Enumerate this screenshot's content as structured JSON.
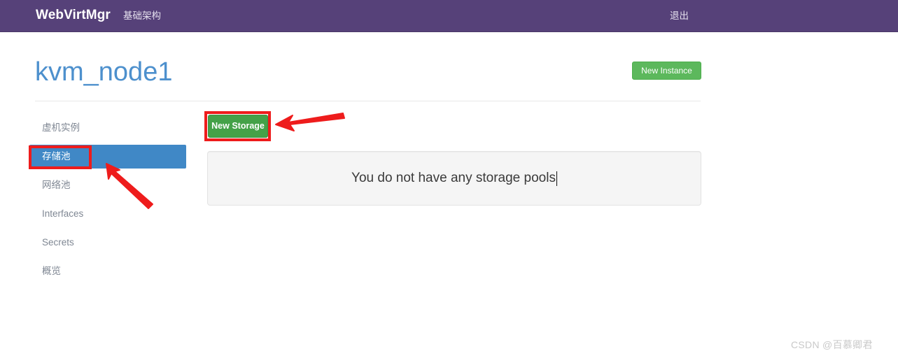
{
  "navbar": {
    "brand": "WebVirtMgr",
    "infrastructure_link": "基础架构",
    "logout_link": "退出",
    "background_color": "#564179"
  },
  "header": {
    "page_title": "kvm_node1",
    "title_color": "#4d90cd",
    "new_instance_button": "New Instance",
    "new_instance_color": "#5cb85c"
  },
  "sidebar": {
    "items": [
      {
        "label": "虚机实例",
        "active": false
      },
      {
        "label": "存储池",
        "active": true
      },
      {
        "label": "网络池",
        "active": false
      },
      {
        "label": "Interfaces",
        "active": false
      },
      {
        "label": "Secrets",
        "active": false
      },
      {
        "label": "概览",
        "active": false
      }
    ],
    "active_color": "#4088c6"
  },
  "main": {
    "new_storage_button": "New Storage",
    "new_storage_color": "#44a148",
    "empty_message": "You do not have any storage pools",
    "panel_background": "#f5f5f5"
  },
  "annotations": {
    "highlight_color": "#ee1c1c",
    "boxes": [
      {
        "target": "new-storage-button"
      },
      {
        "target": "sidebar-item-storage-pool"
      }
    ],
    "arrows": [
      {
        "target": "new-storage-button",
        "direction": "left"
      },
      {
        "target": "sidebar-item-storage-pool",
        "direction": "up-left"
      }
    ]
  },
  "watermark": {
    "text": "CSDN @百慕卿君"
  }
}
